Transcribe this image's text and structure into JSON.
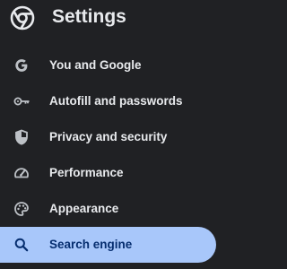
{
  "header": {
    "title": "Settings",
    "logo_icon": "chrome-logo-icon"
  },
  "nav": {
    "items": [
      {
        "label": "You and Google",
        "icon": "google-g-icon"
      },
      {
        "label": "Autofill and passwords",
        "icon": "key-icon"
      },
      {
        "label": "Privacy and security",
        "icon": "shield-icon"
      },
      {
        "label": "Performance",
        "icon": "speedometer-icon"
      },
      {
        "label": "Appearance",
        "icon": "palette-icon"
      },
      {
        "label": "Search engine",
        "icon": "search-icon",
        "selected": true
      }
    ]
  },
  "colors": {
    "background": "#202124",
    "text": "#e8eaed",
    "icon": "#bdc1c6",
    "selected_bg": "#a8c7fa",
    "selected_text": "#062e6f"
  }
}
